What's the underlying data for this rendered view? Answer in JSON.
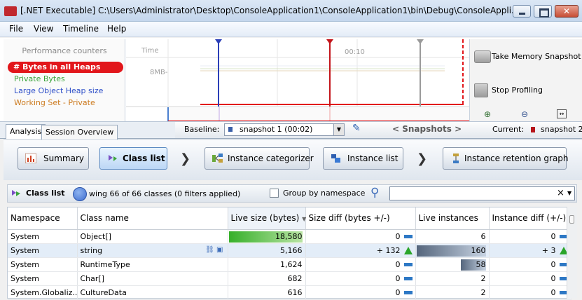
{
  "window": {
    "title": "[.NET Executable] C:\\Users\\Administrator\\Desktop\\ConsoleApplication1\\ConsoleApplication1\\bin\\Debug\\ConsoleAppli..."
  },
  "menu": [
    "File",
    "View",
    "Timeline",
    "Help"
  ],
  "timeline": {
    "counters_heading": "Performance counters",
    "counters": [
      {
        "label": "# Bytes in all Heaps",
        "color": "#e2161b"
      },
      {
        "label": "Private Bytes",
        "color": "#3aa53a"
      },
      {
        "label": "Large Object Heap size",
        "color": "#2e4fc8"
      },
      {
        "label": "Working Set - Private",
        "color": "#cc7a1e"
      }
    ],
    "time_label": "Time",
    "time_tick": "00:10",
    "y_label": "8MB-",
    "take_snapshot": "Take Memory Snapshot",
    "stop_profiling": "Stop Profiling"
  },
  "tabs": [
    "Analysis",
    "Session Overview"
  ],
  "baseline": {
    "label": "Baseline:",
    "value": "snapshot 1 (00:02)",
    "snapshots_label": "< Snapshots >",
    "current_label": "Current:",
    "current_value": "snapshot 2"
  },
  "nav": {
    "summary": "Summary",
    "class_list": "Class list",
    "instance_categorizer": "Instance categorizer",
    "instance_list": "Instance list",
    "retention_graph": "Instance retention graph"
  },
  "classlist": {
    "title": "Class list",
    "status": "wing 66 of 66 classes (0 filters applied)",
    "group_label": "Group by namespace",
    "clear": "×"
  },
  "table": {
    "columns": [
      "Namespace",
      "Class name",
      "Live size (bytes)",
      "Size diff (bytes +/-)",
      "Live instances",
      "Instance diff (+/-)"
    ],
    "rows": [
      {
        "ns": "System",
        "cls": "Object[]",
        "live": "18,580",
        "live_frac": 1.0,
        "sdiff": "0",
        "sdir": "flat",
        "inst": "6",
        "inst_frac": 0.0,
        "idiff": "0",
        "idir": "flat"
      },
      {
        "ns": "System",
        "cls": "string",
        "live": "5,166",
        "live_frac": 0.0,
        "sdiff": "+ 132",
        "sdir": "up",
        "inst": "160",
        "inst_frac": 1.0,
        "idiff": "+ 3",
        "idir": "up"
      },
      {
        "ns": "System",
        "cls": "RuntimeType",
        "live": "1,624",
        "live_frac": 0.0,
        "sdiff": "0",
        "sdir": "flat",
        "inst": "58",
        "inst_frac": 0.36,
        "idiff": "0",
        "idir": "flat"
      },
      {
        "ns": "System",
        "cls": "Char[]",
        "live": "682",
        "live_frac": 0.0,
        "sdiff": "0",
        "sdir": "flat",
        "inst": "2",
        "inst_frac": 0.0,
        "idiff": "0",
        "idir": "flat"
      },
      {
        "ns": "System.Globaliz...",
        "cls": "CultureData",
        "live": "616",
        "live_frac": 0.0,
        "sdiff": "0",
        "sdir": "flat",
        "inst": "2",
        "inst_frac": 0.0,
        "idiff": "0",
        "idir": "flat"
      }
    ]
  }
}
